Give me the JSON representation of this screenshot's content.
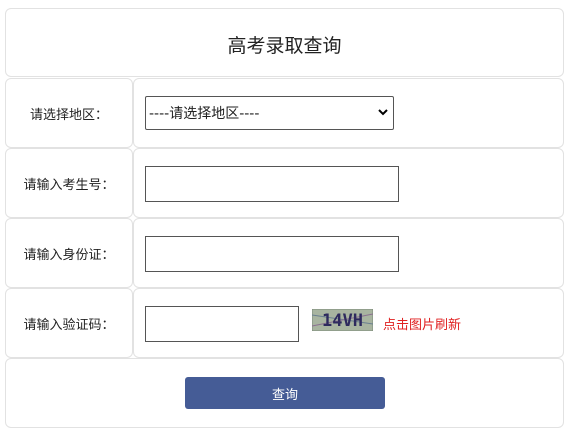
{
  "page": {
    "title": "高考录取查询"
  },
  "form": {
    "region": {
      "label": "请选择地区：",
      "selected": "----请选择地区----"
    },
    "exam_no": {
      "label": "请输入考生号：",
      "value": ""
    },
    "id_no": {
      "label": "请输入身份证：",
      "value": ""
    },
    "captcha": {
      "label": "请输入验证码：",
      "value": "",
      "image_text": "14VH",
      "refresh_label": "点击图片刷新"
    },
    "submit_label": "查询"
  },
  "colors": {
    "button": "#455c96",
    "refresh_link": "#e02020",
    "border": "#e2e2e2"
  },
  "icons": {
    "select_arrow": "chevron-down-icon",
    "captcha": "captcha-image"
  }
}
